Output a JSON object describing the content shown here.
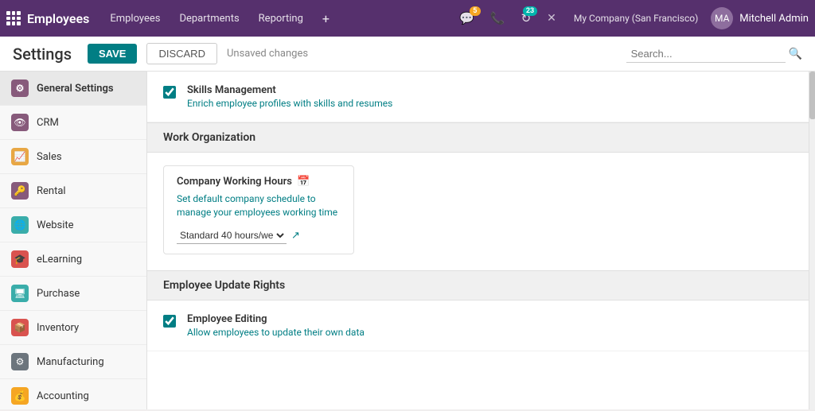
{
  "topnav": {
    "logo_text": "Employees",
    "links": [
      "Employees",
      "Departments",
      "Reporting"
    ],
    "plus_label": "+",
    "chat_badge": "5",
    "refresh_badge": "23",
    "company": "My Company (San Francisco)",
    "username": "Mitchell Admin"
  },
  "subheader": {
    "title": "Settings",
    "save_label": "SAVE",
    "discard_label": "DISCARD",
    "unsaved_label": "Unsaved changes",
    "search_placeholder": "Search..."
  },
  "sidebar": {
    "items": [
      {
        "id": "general-settings",
        "label": "General Settings",
        "icon": "⚙",
        "color": "#875a7b",
        "active": true
      },
      {
        "id": "crm",
        "label": "CRM",
        "icon": "👁",
        "color": "#875a7b"
      },
      {
        "id": "sales",
        "label": "Sales",
        "icon": "📈",
        "color": "#e8a744"
      },
      {
        "id": "rental",
        "label": "Rental",
        "icon": "🔑",
        "color": "#875a7b"
      },
      {
        "id": "website",
        "label": "Website",
        "icon": "🌐",
        "color": "#3aadaa"
      },
      {
        "id": "elearning",
        "label": "eLearning",
        "icon": "🎓",
        "color": "#d9534f"
      },
      {
        "id": "purchase",
        "label": "Purchase",
        "icon": "🖥",
        "color": "#3aadaa"
      },
      {
        "id": "inventory",
        "label": "Inventory",
        "icon": "📦",
        "color": "#d9534f"
      },
      {
        "id": "manufacturing",
        "label": "Manufacturing",
        "icon": "⚙",
        "color": "#6c757d"
      },
      {
        "id": "accounting",
        "label": "Accounting",
        "icon": "💰",
        "color": "#f5a623"
      }
    ]
  },
  "content": {
    "skills_section": {
      "title": "Skills Management",
      "description": "Enrich employee profiles with skills and resumes",
      "checked": true
    },
    "work_org_header": "Work Organization",
    "work_org": {
      "card_title": "Company Working Hours",
      "card_icon": "📅",
      "card_desc": "Set default company schedule to manage your employees working time",
      "select_value": "Standard 40 hours/we"
    },
    "employee_update_header": "Employee Update Rights",
    "employee_editing": {
      "title": "Employee Editing",
      "description": "Allow employees to update their own data",
      "checked": true
    }
  }
}
